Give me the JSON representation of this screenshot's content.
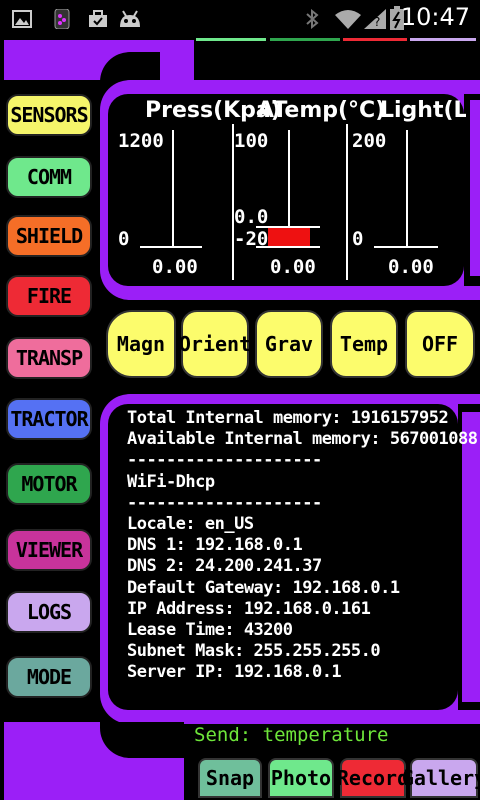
{
  "status_bar": {
    "time": "10:47",
    "icons": [
      "image-icon",
      "bbm-icon",
      "briefcase-icon",
      "android-icon",
      "bluetooth-icon",
      "wifi-icon",
      "signal-icon",
      "battery-icon"
    ]
  },
  "sidebar": [
    {
      "label": "SENSORS",
      "color": "#f5f56a"
    },
    {
      "label": "COMM",
      "color": "#6fe88c"
    },
    {
      "label": "SHIELD",
      "color": "#f56e27"
    },
    {
      "label": "FIRE",
      "color": "#ee2a35"
    },
    {
      "label": "TRANSP",
      "color": "#ef6d9c"
    },
    {
      "label": "TRACTOR",
      "color": "#5571f3"
    },
    {
      "label": "MOTOR",
      "color": "#2fa64e"
    },
    {
      "label": "VIEWER",
      "color": "#c8339b"
    },
    {
      "label": "LOGS",
      "color": "#c9a7ee"
    },
    {
      "label": "MODE",
      "color": "#6ba89e"
    }
  ],
  "gauges": [
    {
      "title": "Press(Kpa)",
      "max": "1200",
      "min": "0",
      "value_label": "0.00",
      "value": 0
    },
    {
      "title": "ATemp(°C)",
      "max": "100",
      "min": "-20",
      "value_label": "0.00",
      "mid": "0.0",
      "value": 0
    },
    {
      "title": "Light(Lu",
      "max": "200",
      "min": "0",
      "value_label": "0.00",
      "value": 0
    }
  ],
  "modes": [
    "Magn",
    "Orient",
    "Grav",
    "Temp",
    "OFF"
  ],
  "info_lines": [
    "Total Internal memory: 1916157952",
    "Available Internal memory: 567001088",
    "--------------------",
    "WiFi-Dhcp",
    "--------------------",
    "Locale: en_US",
    "DNS 1: 192.168.0.1",
    "DNS 2: 24.200.241.37",
    "Default Gateway: 192.168.0.1",
    "IP Address: 192.168.0.161",
    "Lease Time: 43200",
    "Subnet Mask: 255.255.255.0",
    "Server IP: 192.168.0.1"
  ],
  "send_status": "Send: temperature",
  "bottom_buttons": [
    {
      "label": "Snap",
      "color": "#6fbf9b"
    },
    {
      "label": "Photo",
      "color": "#6fe88c"
    },
    {
      "label": "Record",
      "color": "#ee2a35"
    },
    {
      "label": "Gallery",
      "color": "#c9a7ee"
    }
  ],
  "colors": {
    "frame": "#9b1ff7",
    "mode_btn": "#fcfc6c",
    "send_text": "#6ee53a",
    "bar_fill": "#ee1111"
  }
}
